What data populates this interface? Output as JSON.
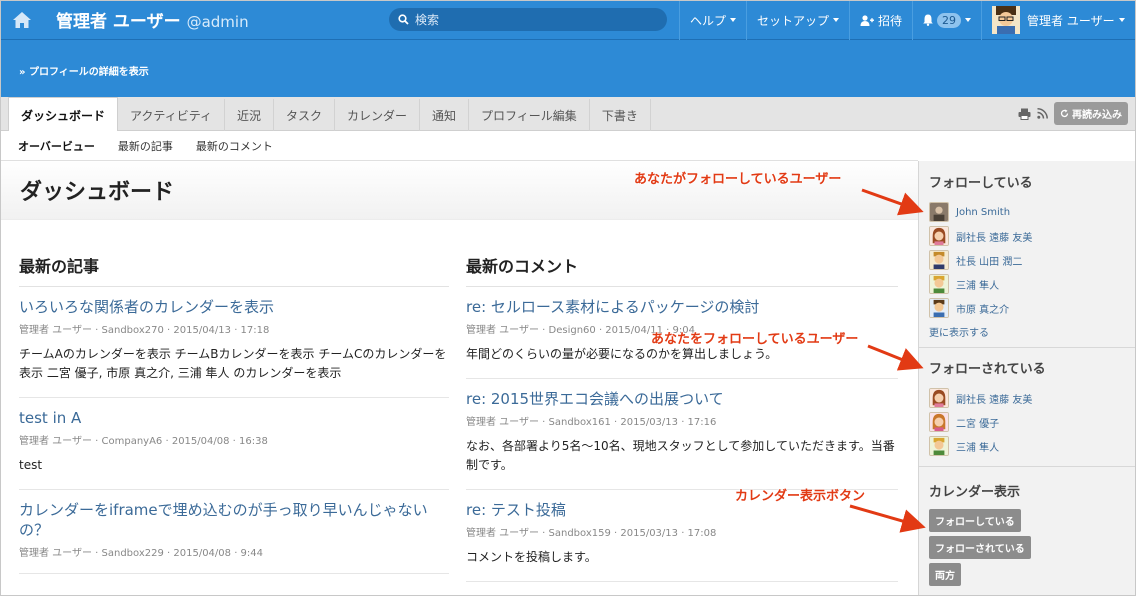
{
  "topbar": {
    "title": "管理者 ユーザー",
    "handle": "@admin",
    "search_placeholder": "検索",
    "help": "ヘルプ",
    "setup": "セットアップ",
    "invite": "招待",
    "notifications": "29",
    "user_name": "管理者 ユーザー"
  },
  "band": {
    "profile_link": "» プロフィールの詳細を表示"
  },
  "tabs": [
    {
      "label": "ダッシュボード"
    },
    {
      "label": "アクティビティ"
    },
    {
      "label": "近況"
    },
    {
      "label": "タスク"
    },
    {
      "label": "カレンダー"
    },
    {
      "label": "通知"
    },
    {
      "label": "プロフィール編集"
    },
    {
      "label": "下書き"
    }
  ],
  "reload_label": "再読み込み",
  "subtabs": [
    {
      "label": "オーバービュー"
    },
    {
      "label": "最新の記事"
    },
    {
      "label": "最新のコメント"
    }
  ],
  "page_title": "ダッシュボード",
  "articles": {
    "heading": "最新の記事",
    "items": [
      {
        "title": "いろいろな関係者のカレンダーを表示",
        "meta": "管理者 ユーザー · Sandbox270 · 2015/04/13 · 17:18",
        "body": "チームAのカレンダーを表示 チームBカレンダーを表示 チームCのカレンダーを表示 二宮 優子, 市原 真之介, 三浦 隼人 のカレンダーを表示"
      },
      {
        "title": "test in A",
        "meta": "管理者 ユーザー · CompanyA6 · 2015/04/08 · 16:38",
        "body": "test"
      },
      {
        "title": "カレンダーをiframeで埋め込むのが手っ取り早いんじゃないの？",
        "meta": "管理者 ユーザー · Sandbox229 · 2015/04/08 · 9:44",
        "body": ""
      }
    ]
  },
  "comments": {
    "heading": "最新のコメント",
    "items": [
      {
        "title": "re: セルロース素材によるパッケージの検討",
        "meta": "管理者 ユーザー · Design60 · 2015/04/11 · 9:04",
        "body": "年間どのくらいの量が必要になるのかを算出しましょう。"
      },
      {
        "title": "re: 2015世界エコ会議への出展ついて",
        "meta": "管理者 ユーザー · Sandbox161 · 2015/03/13 · 17:16",
        "body": "なお、各部署より5名～10名、現地スタッフとして参加していただきます。当番制です。"
      },
      {
        "title": "re: テスト投稿",
        "meta": "管理者 ユーザー · Sandbox159 · 2015/03/13 · 17:08",
        "body": "コメントを投稿します。"
      }
    ]
  },
  "sidebar": {
    "following": {
      "title": "フォローしている",
      "users": [
        "John Smith",
        "副社長 遠藤 友美",
        "社長 山田 潤二",
        "三浦 隼人",
        "市原 真之介"
      ],
      "more": "更に表示する"
    },
    "followers": {
      "title": "フォローされている",
      "users": [
        "副社長 遠藤 友美",
        "二宮 優子",
        "三浦 隼人"
      ]
    },
    "calendar": {
      "title": "カレンダー表示",
      "buttons": [
        "フォローしている",
        "フォローされている",
        "両方"
      ]
    }
  },
  "annotations": {
    "following": "あなたがフォローしているユーザー",
    "followers": "あなたをフォローしているユーザー",
    "calendar": "カレンダー表示ボタン"
  },
  "colors": {
    "brand_blue": "#2d8ad6",
    "link": "#3b6a98",
    "annotation": "#e23a14"
  }
}
